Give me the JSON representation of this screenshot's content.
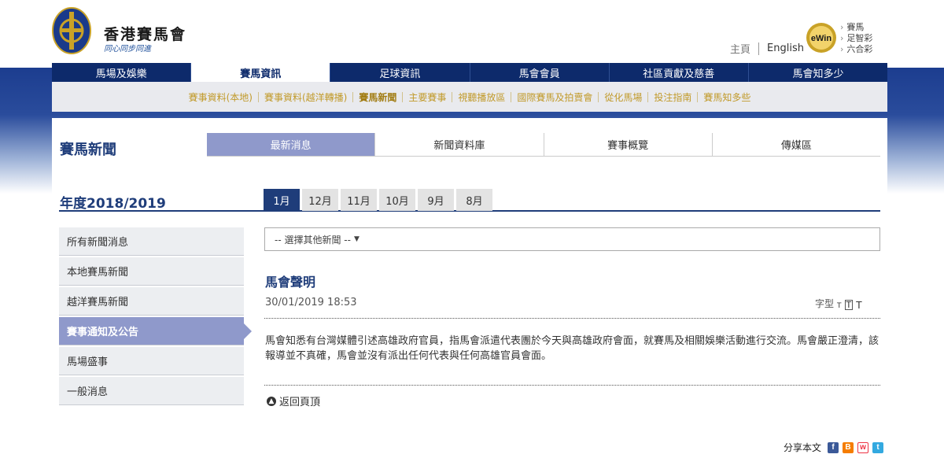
{
  "header": {
    "logo_cn": "香港賽馬會",
    "logo_slogan": "同心同步同進",
    "home_link": "主頁",
    "english_link": "English",
    "ewin_links": [
      "賽馬",
      "足智彩",
      "六合彩"
    ]
  },
  "main_nav": {
    "items": [
      "馬場及娛樂",
      "賽馬資訊",
      "足球資訊",
      "馬會會員",
      "社區貢獻及慈善",
      "馬會知多少"
    ],
    "active_index": 1
  },
  "sub_nav": {
    "items": [
      "賽事資料(本地)",
      "賽事資料(越洋轉播)",
      "賽馬新聞",
      "主要賽事",
      "視聽播放區",
      "國際賽馬及拍賣會",
      "從化馬場",
      "投注指南",
      "賽馬知多些"
    ],
    "active_index": 2
  },
  "section": {
    "title": "賽馬新聞",
    "tabs": [
      "最新消息",
      "新聞資料庫",
      "賽事概覽",
      "傳媒區"
    ],
    "active_tab": 0
  },
  "year": {
    "title": "年度2018/2019",
    "months": [
      "1月",
      "12月",
      "11月",
      "10月",
      "9月",
      "8月"
    ],
    "active_month": 0
  },
  "sidebar": {
    "items": [
      "所有新聞消息",
      "本地賽馬新聞",
      "越洋賽馬新聞",
      "賽事通知及公告",
      "馬場盛事",
      "一般消息"
    ],
    "active_index": 3
  },
  "article": {
    "select_placeholder": "-- 選擇其他新聞 --",
    "title": "馬會聲明",
    "date": "30/01/2019 18:53",
    "font_size_label": "字型",
    "font_sizes": [
      "T",
      "T",
      "T"
    ],
    "body": "馬會知悉有台灣媒體引述高雄政府官員，指馬會派遣代表團於今天與高雄政府會面，就賽馬及相關娛樂活動進行交流。馬會嚴正澄清，該報導並不真確，馬會並沒有派出任何代表與任何高雄官員會面。",
    "back_to_top": "返回頁頂"
  },
  "share": {
    "label": "分享本文"
  },
  "colors": {
    "navy": "#0d2a6b",
    "accent_purple": "#8f99cb",
    "gold": "#c19a2a"
  }
}
